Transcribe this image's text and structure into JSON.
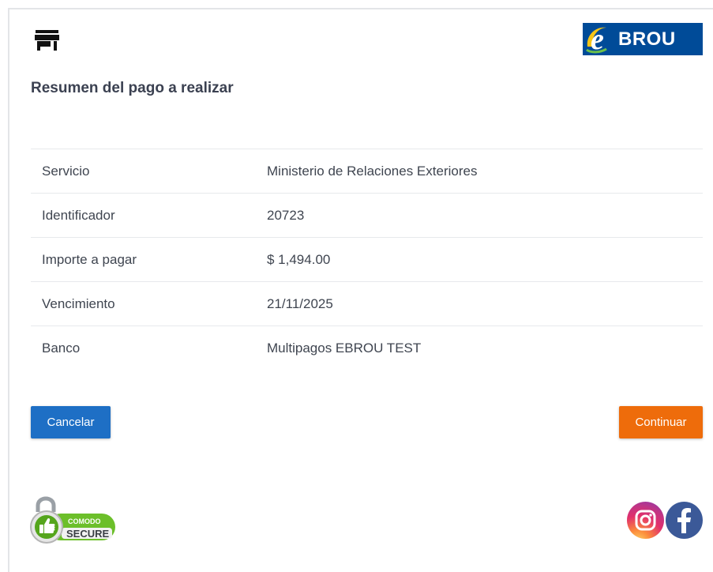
{
  "header": {
    "store_icon": "store-icon",
    "brand": {
      "letter": "e",
      "name": "BROU",
      "color": "#004b98"
    }
  },
  "title": "Resumen del pago a realizar",
  "summary": [
    {
      "label": "Servicio",
      "value": "Ministerio de Relaciones Exteriores"
    },
    {
      "label": "Identificador",
      "value": "20723"
    },
    {
      "label": "Importe a pagar",
      "value": "$ 1,494.00"
    },
    {
      "label": "Vencimiento",
      "value": "21/11/2025"
    },
    {
      "label": "Banco",
      "value": "Multipagos EBROU TEST"
    }
  ],
  "actions": {
    "cancel_label": "Cancelar",
    "cancel_color": "#1e6fc5",
    "continue_label": "Continuar",
    "continue_color": "#ee6c0b"
  },
  "footer": {
    "badge": {
      "top_text": "COMODO",
      "bottom_text": "SECURE",
      "icon": "padlock-thumbs-up-icon"
    },
    "social": [
      {
        "name": "instagram",
        "icon": "instagram-icon"
      },
      {
        "name": "facebook",
        "icon": "facebook-icon"
      }
    ]
  }
}
